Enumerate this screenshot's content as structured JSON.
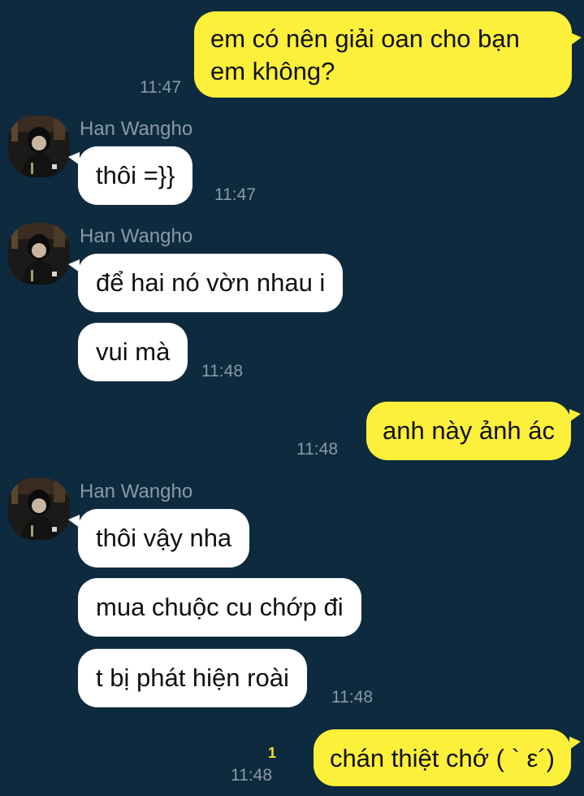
{
  "contact": {
    "name": "Han Wangho",
    "avatar_icon": "profile-photo"
  },
  "colors": {
    "background": "#0e2a3e",
    "outgoing_bubble": "#fdf03a",
    "incoming_bubble": "#ffffff",
    "timestamp": "#8a99a5",
    "unread_count": "#f2e32e"
  },
  "messages": {
    "m1": {
      "text": "em có nên giải oan cho bạn",
      "text2": "em không?",
      "time": "11:47"
    },
    "g1": {
      "sender": "Han Wangho",
      "time": "11:47"
    },
    "m2": {
      "text": "thôi =}}"
    },
    "g2": {
      "sender": "Han Wangho",
      "time": "11:48"
    },
    "m3": {
      "text": "để hai nó vờn nhau i"
    },
    "m4": {
      "text": "vui mà"
    },
    "m5": {
      "text": "anh này ảnh ác",
      "time": "11:48"
    },
    "g3": {
      "sender": "Han Wangho",
      "time": "11:48"
    },
    "m6": {
      "text": "thôi vậy nha"
    },
    "m7": {
      "text": "mua chuộc cu chớp đi"
    },
    "m8": {
      "text": "t bị phát hiện roài"
    },
    "m9": {
      "text": "chán thiệt chớ ( ` ε´)",
      "time": "11:48",
      "unread": "1"
    }
  }
}
